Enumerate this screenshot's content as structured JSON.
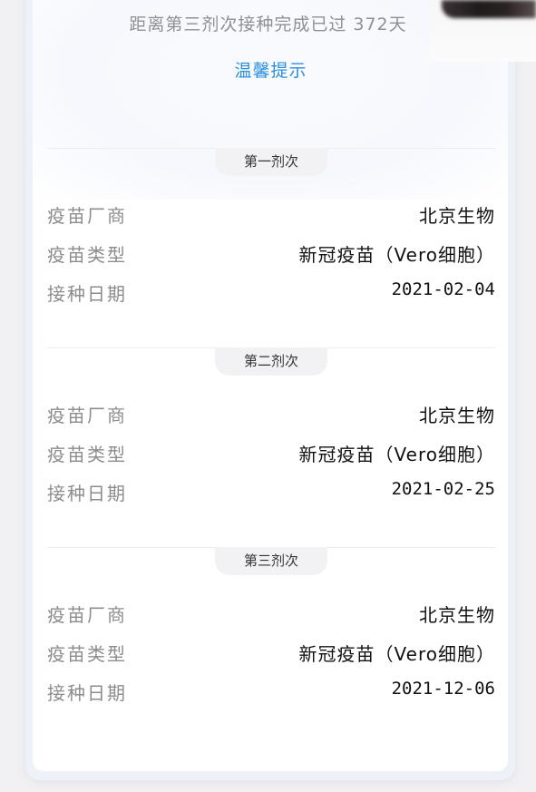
{
  "header": {
    "countdown_text": "距离第三剂次接种完成已过 372天",
    "tips_link": "温馨提示"
  },
  "doses": [
    {
      "title": "第一剂次",
      "manufacturer_label": "疫苗厂商",
      "manufacturer": "北京生物",
      "type_label": "疫苗类型",
      "type": "新冠疫苗（Vero细胞）",
      "date_label": "接种日期",
      "date": "2021-02-04"
    },
    {
      "title": "第二剂次",
      "manufacturer_label": "疫苗厂商",
      "manufacturer": "北京生物",
      "type_label": "疫苗类型",
      "type": "新冠疫苗（Vero细胞）",
      "date_label": "接种日期",
      "date": "2021-02-25"
    },
    {
      "title": "第三剂次",
      "manufacturer_label": "疫苗厂商",
      "manufacturer": "北京生物",
      "type_label": "疫苗类型",
      "type": "新冠疫苗（Vero细胞）",
      "date_label": "接种日期",
      "date": "2021-12-06"
    }
  ],
  "colors": {
    "link": "#2b8fe0",
    "label": "#8c8c90",
    "value": "#111111",
    "pill_bg": "#f2f2f4"
  }
}
